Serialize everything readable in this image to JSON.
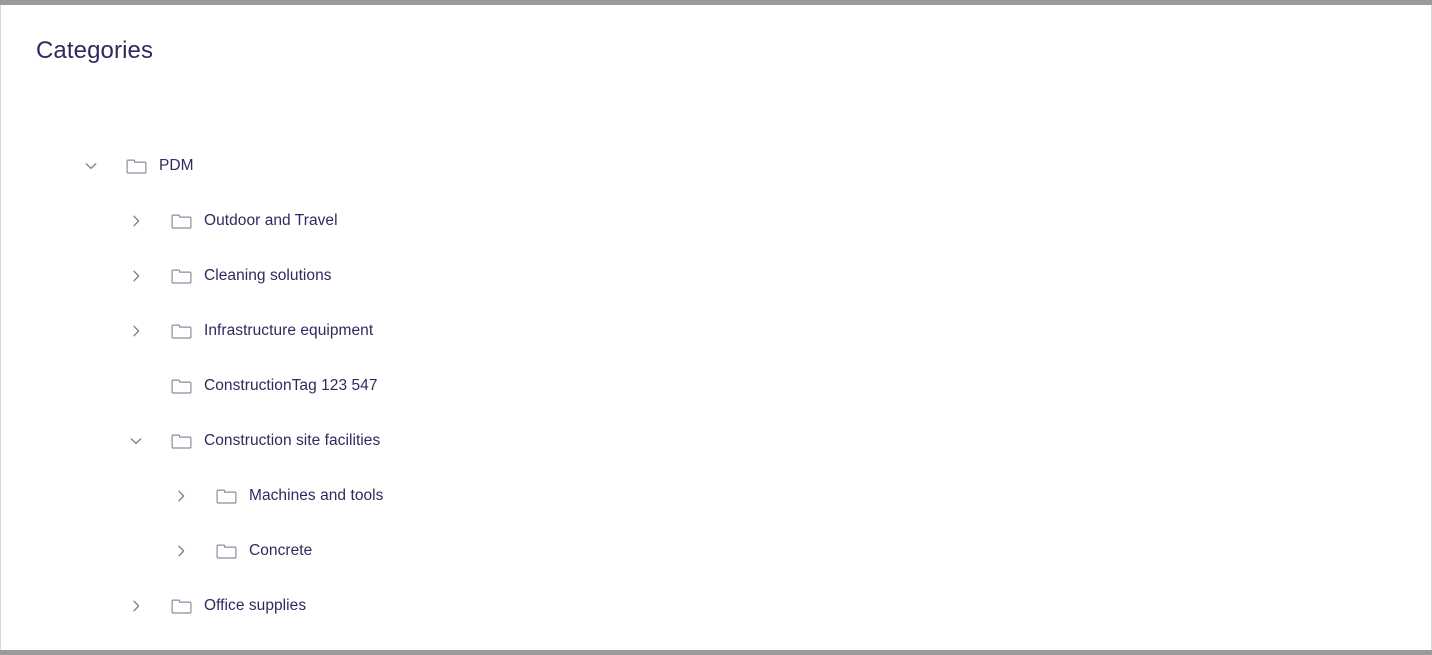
{
  "page": {
    "title": "Categories"
  },
  "colors": {
    "title_text": "#2f2a5e",
    "node_text": "#2f2a5e",
    "folder_icon": "#8c8ca0",
    "chevron": "#7e7e90",
    "frame_bar": "#9b9b9b",
    "divider": "#ededf0",
    "background": "#ffffff"
  },
  "tree": {
    "name": "categories-tree",
    "nodes": [
      {
        "label": "PDM",
        "level": 0,
        "expanded": true,
        "has_children": true,
        "twisty_icon": "chevron-down-icon",
        "folder_icon": "folder-icon"
      },
      {
        "label": "Outdoor and Travel",
        "level": 1,
        "expanded": false,
        "has_children": true,
        "twisty_icon": "chevron-right-icon",
        "folder_icon": "folder-icon"
      },
      {
        "label": "Cleaning solutions",
        "level": 1,
        "expanded": false,
        "has_children": true,
        "twisty_icon": "chevron-right-icon",
        "folder_icon": "folder-icon"
      },
      {
        "label": "Infrastructure equipment",
        "level": 1,
        "expanded": false,
        "has_children": true,
        "twisty_icon": "chevron-right-icon",
        "folder_icon": "folder-icon"
      },
      {
        "label": "ConstructionTag 123 547",
        "level": 1,
        "expanded": false,
        "has_children": false,
        "twisty_icon": "",
        "folder_icon": "folder-icon"
      },
      {
        "label": "Construction site facilities",
        "level": 1,
        "expanded": true,
        "has_children": true,
        "twisty_icon": "chevron-down-icon",
        "folder_icon": "folder-icon"
      },
      {
        "label": "Machines and tools",
        "level": 2,
        "expanded": false,
        "has_children": true,
        "twisty_icon": "chevron-right-icon",
        "folder_icon": "folder-icon"
      },
      {
        "label": "Concrete",
        "level": 2,
        "expanded": false,
        "has_children": true,
        "twisty_icon": "chevron-right-icon",
        "folder_icon": "folder-icon"
      },
      {
        "label": "Office supplies",
        "level": 1,
        "expanded": false,
        "has_children": true,
        "twisty_icon": "chevron-right-icon",
        "folder_icon": "folder-icon"
      }
    ]
  }
}
